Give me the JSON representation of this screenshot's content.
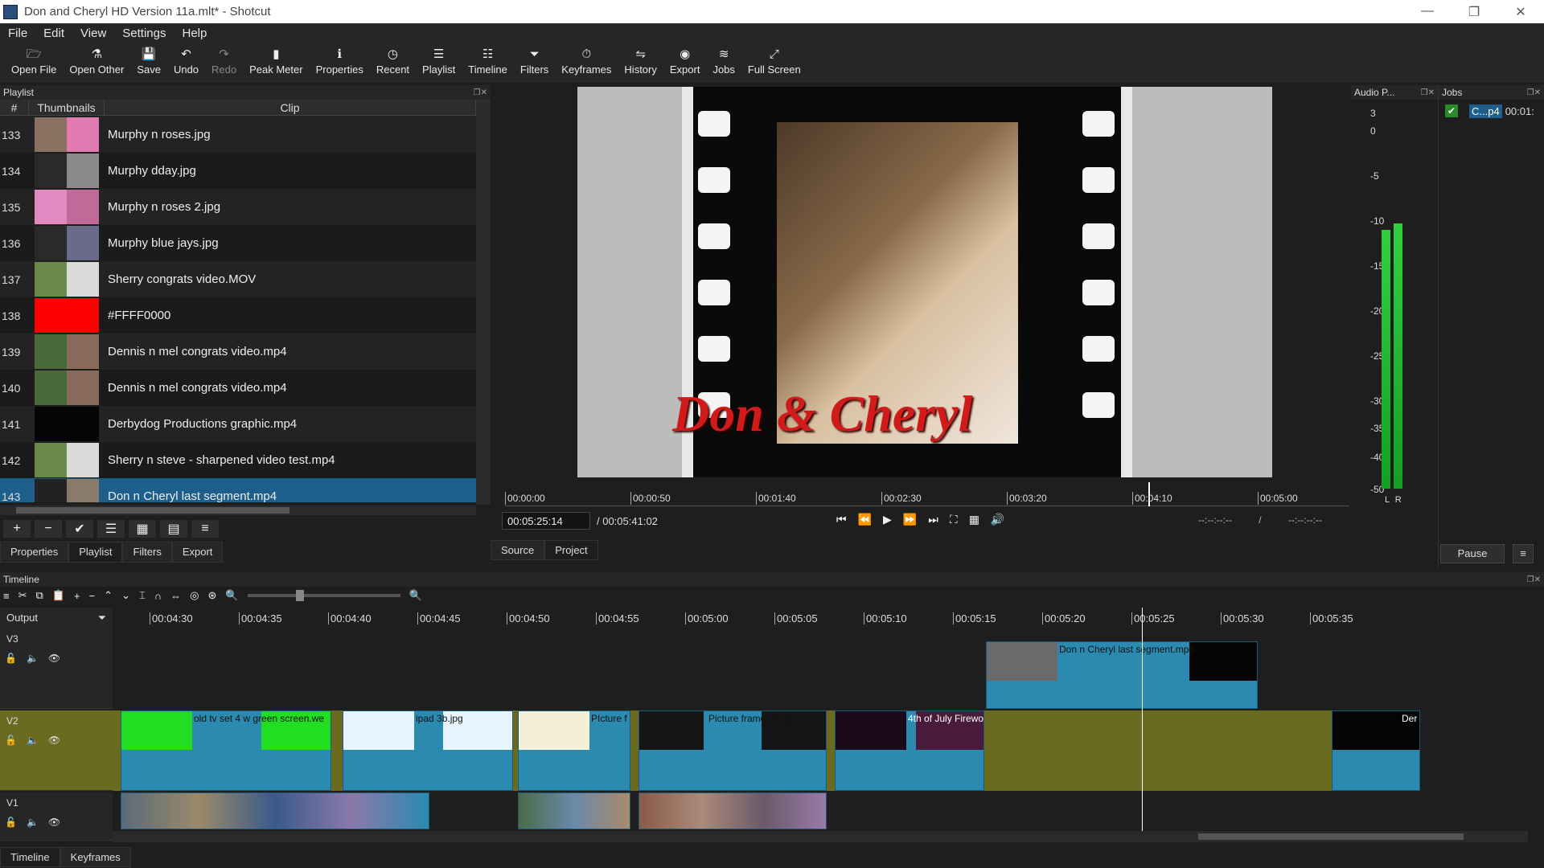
{
  "window": {
    "title": "Don and Cheryl HD Version 11a.mlt* - Shotcut",
    "minimize": "—",
    "maximize": "❐",
    "close": "✕"
  },
  "menu": [
    "File",
    "Edit",
    "View",
    "Settings",
    "Help"
  ],
  "toolbar": [
    {
      "label": "Open File",
      "icon": "open-file-icon",
      "glyph": "🗁"
    },
    {
      "label": "Open Other",
      "icon": "open-other-icon",
      "glyph": "⚗"
    },
    {
      "label": "Save",
      "icon": "save-icon",
      "glyph": "💾"
    },
    {
      "label": "Undo",
      "icon": "undo-icon",
      "glyph": "↶"
    },
    {
      "label": "Redo",
      "icon": "redo-icon",
      "glyph": "↷",
      "disabled": true
    },
    {
      "label": "Peak Meter",
      "icon": "peak-meter-icon",
      "glyph": "▮"
    },
    {
      "label": "Properties",
      "icon": "properties-icon",
      "glyph": "ℹ"
    },
    {
      "label": "Recent",
      "icon": "recent-icon",
      "glyph": "◷"
    },
    {
      "label": "Playlist",
      "icon": "playlist-icon",
      "glyph": "☰"
    },
    {
      "label": "Timeline",
      "icon": "timeline-icon",
      "glyph": "☷"
    },
    {
      "label": "Filters",
      "icon": "filters-icon",
      "glyph": "⏷"
    },
    {
      "label": "Keyframes",
      "icon": "keyframes-icon",
      "glyph": "⏱"
    },
    {
      "label": "History",
      "icon": "history-icon",
      "glyph": "⇋"
    },
    {
      "label": "Export",
      "icon": "export-icon",
      "glyph": "◉"
    },
    {
      "label": "Jobs",
      "icon": "jobs-icon",
      "glyph": "≋"
    },
    {
      "label": "Full Screen",
      "icon": "full-screen-icon",
      "glyph": "⤢"
    }
  ],
  "playlist": {
    "title": "Playlist",
    "columns": [
      "#",
      "Thumbnails",
      "Clip"
    ],
    "rows": [
      {
        "num": "133",
        "name": "Murphy n roses.jpg",
        "c1": "#8a7060",
        "c2": "#e07ab0"
      },
      {
        "num": "134",
        "name": "Murphy dday.jpg",
        "c1": "#2a2a2a",
        "c2": "#8a8a8a"
      },
      {
        "num": "135",
        "name": "Murphy n roses 2.jpg",
        "c1": "#e08ac0",
        "c2": "#c06a9a"
      },
      {
        "num": "136",
        "name": "Murphy blue jays.jpg",
        "c1": "#2a2a2a",
        "c2": "#6a6a8a"
      },
      {
        "num": "137",
        "name": "Sherry congrats video.MOV",
        "c1": "#6a8a4a",
        "c2": "#dadada"
      },
      {
        "num": "138",
        "name": "#FFFF0000",
        "c1": "#ff0000",
        "c2": "#ff0000"
      },
      {
        "num": "139",
        "name": "Dennis n mel congrats video.mp4",
        "c1": "#4a6a3a",
        "c2": "#8a6a5a"
      },
      {
        "num": "140",
        "name": "Dennis n mel congrats video.mp4",
        "c1": "#4a6a3a",
        "c2": "#8a6a5a"
      },
      {
        "num": "141",
        "name": "Derbydog Productions graphic.mp4",
        "c1": "#050505",
        "c2": "#050505"
      },
      {
        "num": "142",
        "name": "Sherry n steve - sharpened video test.mp4",
        "c1": "#6a8a4a",
        "c2": "#dadada"
      },
      {
        "num": "143",
        "name": "Don n Cheryl last segment.mp4",
        "c1": "#222",
        "c2": "#8a7a6a",
        "selected": true
      }
    ],
    "actions": [
      {
        "icon": "add-icon",
        "glyph": "+"
      },
      {
        "icon": "remove-icon",
        "glyph": "−"
      },
      {
        "icon": "update-icon",
        "glyph": "✔"
      },
      {
        "icon": "details-view-icon",
        "glyph": "☰"
      },
      {
        "icon": "tiles-view-icon",
        "glyph": "▦"
      },
      {
        "icon": "icons-view-icon",
        "glyph": "▤"
      },
      {
        "icon": "menu-icon",
        "glyph": "≡"
      }
    ]
  },
  "left_tabs": [
    "Properties",
    "Playlist",
    "Filters",
    "Export"
  ],
  "viewer": {
    "overlay_text": "Don & Cheryl",
    "ruler": [
      "00:00:00",
      "00:00:50",
      "00:01:40",
      "00:02:30",
      "00:03:20",
      "00:04:10",
      "00:05:00"
    ],
    "current_time": "00:05:25:14",
    "duration": "/ 00:05:41:02",
    "in_point": "--:--:--:-- /",
    "out_point": "--:--:--:--",
    "tabs": [
      "Source",
      "Project"
    ]
  },
  "audio": {
    "title": "Audio P...",
    "scale": [
      "3",
      "0",
      "-5",
      "-10",
      "-15",
      "-20",
      "-25",
      "-30",
      "-35",
      "-40",
      "-50"
    ],
    "left_label": "L",
    "right_label": "R"
  },
  "jobs": {
    "title": "Jobs",
    "job_name": "C...p4",
    "job_time": "00:01:",
    "pause": "Pause"
  },
  "timeline": {
    "title": "Timeline",
    "output_label": "Output",
    "ruler": [
      "00:04:30",
      "00:04:35",
      "00:04:40",
      "00:04:45",
      "00:04:50",
      "00:04:55",
      "00:05:00",
      "00:05:05",
      "00:05:10",
      "00:05:15",
      "00:05:20",
      "00:05:25",
      "00:05:30",
      "00:05:35"
    ],
    "tracks": [
      "V3",
      "V2",
      "V1"
    ],
    "clips_v3": [
      {
        "title": "Don n Cheryl  last segment.mp4"
      }
    ],
    "clips_v2": [
      {
        "title": "old tv set 4 w green screen.we"
      },
      {
        "title": "ipad 3b.jpg"
      },
      {
        "title": "PIcture f"
      },
      {
        "title": "Picture frame 21.jpg"
      },
      {
        "title": "4th of July Firewo"
      },
      {
        "title": "Der"
      }
    ],
    "bottom_tabs": [
      "Timeline",
      "Keyframes"
    ]
  }
}
